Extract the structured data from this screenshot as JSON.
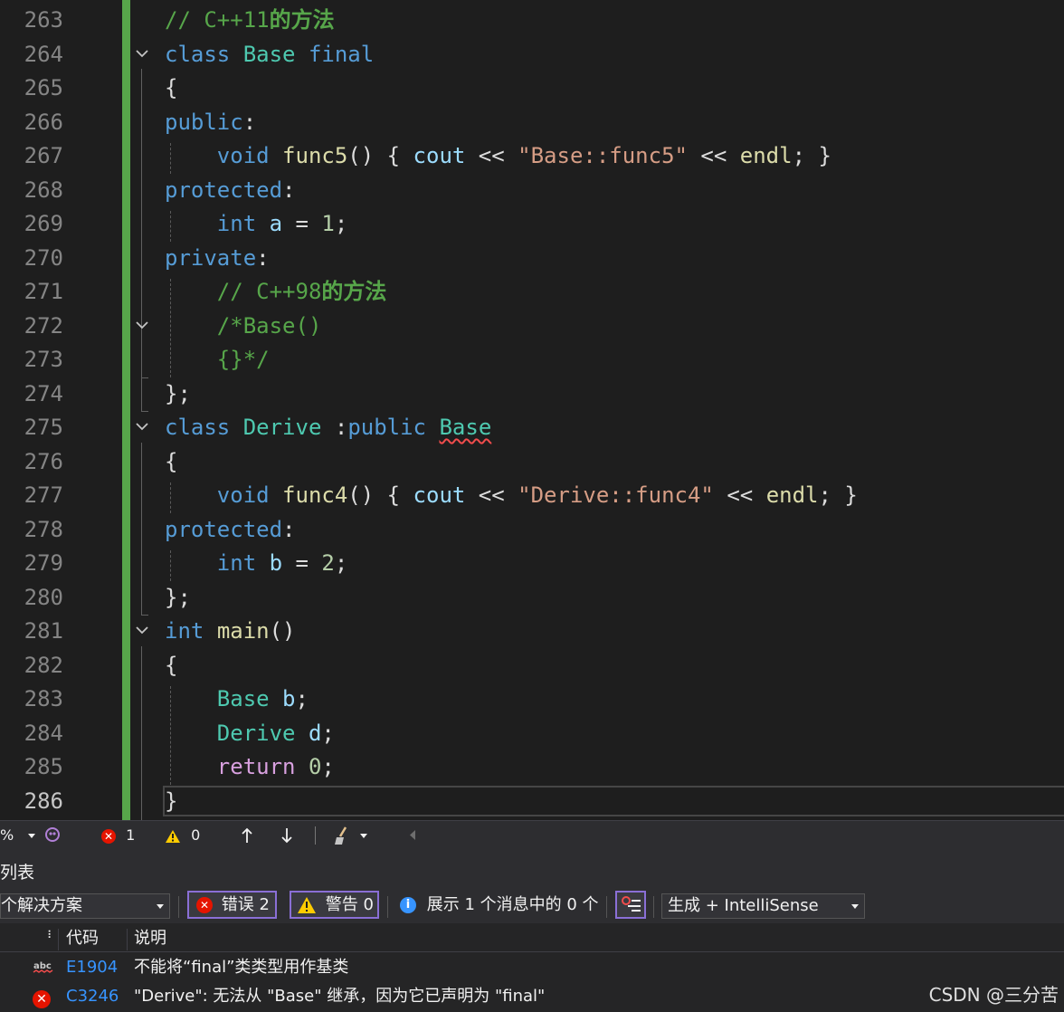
{
  "editor": {
    "lines": [
      {
        "n": "263",
        "tokens": [
          {
            "t": "// C++11",
            "c": "cm"
          },
          {
            "t": "的方法",
            "c": "cmz"
          }
        ]
      },
      {
        "n": "264",
        "fold": true,
        "tokens": [
          {
            "t": "class",
            "c": "kw"
          },
          {
            "t": " "
          },
          {
            "t": "Base",
            "c": "ty"
          },
          {
            "t": " "
          },
          {
            "t": "final",
            "c": "kw"
          }
        ]
      },
      {
        "n": "265",
        "tokens": [
          {
            "t": "{"
          }
        ]
      },
      {
        "n": "266",
        "tokens": [
          {
            "t": "public",
            "c": "kw"
          },
          {
            "t": ":"
          }
        ]
      },
      {
        "n": "267",
        "tokens": [
          {
            "t": "    "
          },
          {
            "t": "void",
            "c": "kw"
          },
          {
            "t": " "
          },
          {
            "t": "func5",
            "c": "fn"
          },
          {
            "t": "() { "
          },
          {
            "t": "cout",
            "c": "va"
          },
          {
            "t": " << "
          },
          {
            "t": "\"Base::func5\"",
            "c": "st"
          },
          {
            "t": " << "
          },
          {
            "t": "endl",
            "c": "fn"
          },
          {
            "t": "; }"
          }
        ]
      },
      {
        "n": "268",
        "tokens": [
          {
            "t": "protected",
            "c": "kw"
          },
          {
            "t": ":"
          }
        ]
      },
      {
        "n": "269",
        "tokens": [
          {
            "t": "    "
          },
          {
            "t": "int",
            "c": "kw"
          },
          {
            "t": " "
          },
          {
            "t": "a",
            "c": "va"
          },
          {
            "t": " = "
          },
          {
            "t": "1",
            "c": "nu"
          },
          {
            "t": ";"
          }
        ]
      },
      {
        "n": "270",
        "tokens": [
          {
            "t": "private",
            "c": "kw"
          },
          {
            "t": ":"
          }
        ]
      },
      {
        "n": "271",
        "tokens": [
          {
            "t": "    "
          },
          {
            "t": "// C++98",
            "c": "cm"
          },
          {
            "t": "的方法",
            "c": "cmz"
          }
        ]
      },
      {
        "n": "272",
        "fold": true,
        "tokens": [
          {
            "t": "    "
          },
          {
            "t": "/*Base()",
            "c": "cm"
          }
        ]
      },
      {
        "n": "273",
        "tokens": [
          {
            "t": "    "
          },
          {
            "t": "{}*/",
            "c": "cm"
          }
        ]
      },
      {
        "n": "274",
        "tokens": [
          {
            "t": "};"
          }
        ]
      },
      {
        "n": "275",
        "fold": true,
        "tokens": [
          {
            "t": "class",
            "c": "kw"
          },
          {
            "t": " "
          },
          {
            "t": "Derive",
            "c": "ty"
          },
          {
            "t": " :"
          },
          {
            "t": "public",
            "c": "kw"
          },
          {
            "t": " "
          },
          {
            "t": "Base",
            "c": "ty squig"
          }
        ]
      },
      {
        "n": "276",
        "tokens": [
          {
            "t": "{"
          }
        ]
      },
      {
        "n": "277",
        "tokens": [
          {
            "t": "    "
          },
          {
            "t": "void",
            "c": "kw"
          },
          {
            "t": " "
          },
          {
            "t": "func4",
            "c": "fn"
          },
          {
            "t": "() { "
          },
          {
            "t": "cout",
            "c": "va"
          },
          {
            "t": " << "
          },
          {
            "t": "\"Derive::func4\"",
            "c": "st"
          },
          {
            "t": " << "
          },
          {
            "t": "endl",
            "c": "fn"
          },
          {
            "t": "; }"
          }
        ]
      },
      {
        "n": "278",
        "tokens": [
          {
            "t": "protected",
            "c": "kw"
          },
          {
            "t": ":"
          }
        ]
      },
      {
        "n": "279",
        "tokens": [
          {
            "t": "    "
          },
          {
            "t": "int",
            "c": "kw"
          },
          {
            "t": " "
          },
          {
            "t": "b",
            "c": "va"
          },
          {
            "t": " = "
          },
          {
            "t": "2",
            "c": "nu"
          },
          {
            "t": ";"
          }
        ]
      },
      {
        "n": "280",
        "tokens": [
          {
            "t": "};"
          }
        ]
      },
      {
        "n": "281",
        "fold": true,
        "tokens": [
          {
            "t": "int",
            "c": "kw"
          },
          {
            "t": " "
          },
          {
            "t": "main",
            "c": "fn"
          },
          {
            "t": "()"
          }
        ]
      },
      {
        "n": "282",
        "tokens": [
          {
            "t": "{"
          }
        ]
      },
      {
        "n": "283",
        "tokens": [
          {
            "t": "    "
          },
          {
            "t": "Base",
            "c": "ty"
          },
          {
            "t": " "
          },
          {
            "t": "b",
            "c": "va"
          },
          {
            "t": ";"
          }
        ]
      },
      {
        "n": "284",
        "tokens": [
          {
            "t": "    "
          },
          {
            "t": "Derive",
            "c": "ty"
          },
          {
            "t": " "
          },
          {
            "t": "d",
            "c": "va"
          },
          {
            "t": ";"
          }
        ]
      },
      {
        "n": "285",
        "tokens": [
          {
            "t": "    "
          },
          {
            "t": "return",
            "c": "ct"
          },
          {
            "t": " "
          },
          {
            "t": "0",
            "c": "nu"
          },
          {
            "t": ";"
          }
        ]
      },
      {
        "n": "286",
        "current": true,
        "tokens": [
          {
            "t": "}"
          }
        ]
      }
    ]
  },
  "status_strip": {
    "zoom_suffix": "%",
    "error_count": "1",
    "warning_count": "0"
  },
  "error_list": {
    "title": "列表",
    "scope": "个解决方案",
    "errors_filter": "错误 2",
    "warnings_filter": "警告 0",
    "messages_filter": "展示 1 个消息中的 0 个",
    "build_source": "生成 + IntelliSense",
    "columns": {
      "code": "代码",
      "description": "说明"
    },
    "rows": [
      {
        "kind": "intellisense",
        "code": "E1904",
        "description": "不能将“final”类类型用作基类"
      },
      {
        "kind": "error",
        "code": "C3246",
        "description": "\"Derive\": 无法从 \"Base\" 继承，因为它已声明为 \"final\""
      }
    ]
  },
  "watermark": "CSDN @三分苦",
  "colors": {
    "change_bar": "#57a64a",
    "keyword": "#569cd6",
    "type": "#4ec9b0",
    "function": "#dcdcaa",
    "string": "#d69d85",
    "comment": "#57a64a",
    "error_red": "#e51400",
    "link_blue": "#3794ff"
  }
}
